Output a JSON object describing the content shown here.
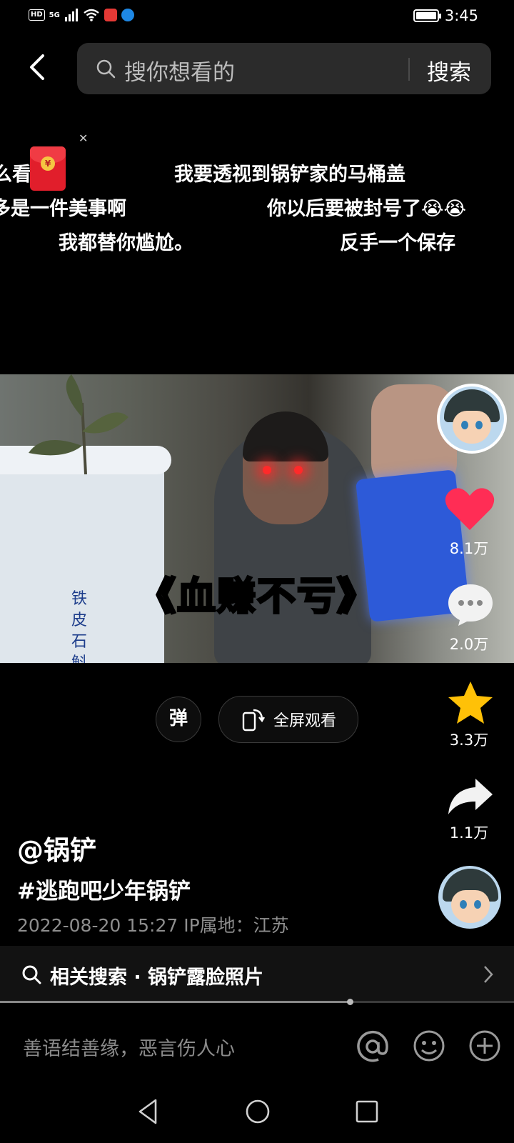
{
  "status_bar": {
    "hd": "HD",
    "signal": "5G",
    "time": "3:45"
  },
  "search": {
    "placeholder": "搜你想看的",
    "button": "搜索"
  },
  "danmaku": [
    {
      "text": "么看懂？"
    },
    {
      "text": "我要透视到锅铲家的马桶盖"
    },
    {
      "text": "多是一件美事啊"
    },
    {
      "text": "你以后要被封号了😭😭"
    },
    {
      "text": "我都替你尴尬。"
    },
    {
      "text": "反手一个保存"
    }
  ],
  "video": {
    "subtitle": "《血赚不亏》",
    "pot_text": "铁皮石斛"
  },
  "actions": {
    "likes": "8.1万",
    "comments": "2.0万",
    "favorites": "3.3万",
    "shares": "1.1万"
  },
  "controls": {
    "danmaku_toggle": "弹",
    "fullscreen": "全屏观看"
  },
  "post": {
    "author": "@锅铲",
    "hashtag": "#逃跑吧少年锅铲",
    "meta": "2022-08-20 15:27  IP属地：江苏"
  },
  "related": {
    "text": "相关搜索 · 锅铲露脸照片"
  },
  "playback": {
    "progress": 0.68
  },
  "comment": {
    "placeholder": "善语结善缘，恶言伤人心"
  },
  "colors": {
    "like": "#ff2d55",
    "favorite": "#ffc107",
    "subtitle": "#ffeb3b"
  }
}
